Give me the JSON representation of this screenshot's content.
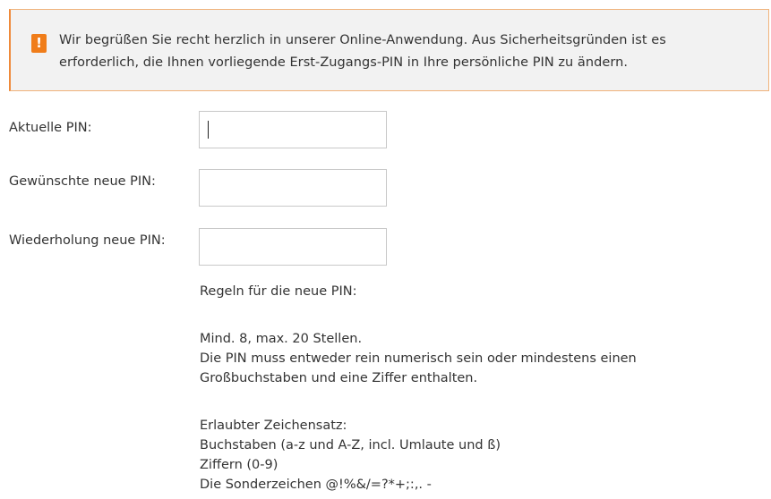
{
  "notice": {
    "icon": "warning-icon",
    "icon_glyph": "!",
    "line1": "Wir begrüßen Sie recht herzlich in unserer Online-Anwendung. Aus Sicherheitsgründen ist es",
    "line2": "erforderlich, die Ihnen vorliegende Erst-Zugangs-PIN in Ihre persönliche PIN zu ändern.",
    "colors": {
      "accent": "#f07d1a",
      "background": "#f2f2f2",
      "border": "#f0b27a"
    }
  },
  "form": {
    "current_pin": {
      "label": "Aktuelle PIN:",
      "value": ""
    },
    "new_pin": {
      "label": "Gewünschte neue PIN:",
      "value": ""
    },
    "repeat_pin": {
      "label": "Wiederholung neue PIN:",
      "value": ""
    }
  },
  "rules": {
    "heading": "Regeln für die neue PIN:",
    "length": "Mind. 8, max. 20 Stellen.",
    "composition_1": "Die PIN muss entweder rein numerisch sein oder mindestens einen",
    "composition_2": "Großbuchstaben und eine Ziffer enthalten.",
    "charset_heading": "Erlaubter Zeichensatz:",
    "charset_letters": "Buchstaben (a-z und A-Z, incl. Umlaute und ß)",
    "charset_digits": "Ziffern (0-9)",
    "charset_special": "Die Sonderzeichen @!%&/=?*+;:,. -"
  }
}
